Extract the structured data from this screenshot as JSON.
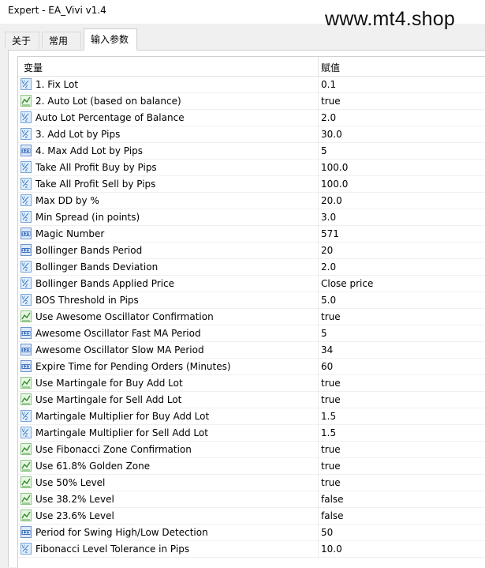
{
  "window": {
    "title": "Expert - EA_Vivi v1.4",
    "watermark": "www.mt4.shop"
  },
  "tabs": [
    {
      "label": "关于",
      "active": false
    },
    {
      "label": "常用",
      "active": false
    },
    {
      "label": "输入参数",
      "active": true
    }
  ],
  "table": {
    "col_variable": "变量",
    "col_value": "赋值",
    "rows": [
      {
        "name": "1. Fix Lot",
        "value": "0.1",
        "type": "double"
      },
      {
        "name": "2. Auto Lot (based on balance)",
        "value": "true",
        "type": "bool"
      },
      {
        "name": "Auto Lot Percentage of Balance",
        "value": "2.0",
        "type": "double"
      },
      {
        "name": "3. Add Lot by Pips",
        "value": "30.0",
        "type": "double"
      },
      {
        "name": "4. Max Add Lot by Pips",
        "value": "5",
        "type": "int"
      },
      {
        "name": "Take All Profit Buy by Pips",
        "value": "100.0",
        "type": "double"
      },
      {
        "name": "Take All Profit Sell by Pips",
        "value": "100.0",
        "type": "double"
      },
      {
        "name": "Max DD by %",
        "value": "20.0",
        "type": "double"
      },
      {
        "name": "Min Spread (in points)",
        "value": "3.0",
        "type": "double"
      },
      {
        "name": "Magic Number",
        "value": "571",
        "type": "int"
      },
      {
        "name": "Bollinger Bands Period",
        "value": "20",
        "type": "int"
      },
      {
        "name": "Bollinger Bands Deviation",
        "value": "2.0",
        "type": "double"
      },
      {
        "name": "Bollinger Bands Applied Price",
        "value": "Close price",
        "type": "double"
      },
      {
        "name": "BOS Threshold in Pips",
        "value": "5.0",
        "type": "double"
      },
      {
        "name": "Use Awesome Oscillator Confirmation",
        "value": "true",
        "type": "bool"
      },
      {
        "name": "Awesome Oscillator Fast MA Period",
        "value": "5",
        "type": "int"
      },
      {
        "name": "Awesome Oscillator Slow MA Period",
        "value": "34",
        "type": "int"
      },
      {
        "name": "Expire Time for Pending Orders (Minutes)",
        "value": "60",
        "type": "int"
      },
      {
        "name": "Use Martingale for Buy Add Lot",
        "value": "true",
        "type": "bool"
      },
      {
        "name": "Use Martingale for Sell Add Lot",
        "value": "true",
        "type": "bool"
      },
      {
        "name": "Martingale Multiplier for Buy Add Lot",
        "value": "1.5",
        "type": "double"
      },
      {
        "name": "Martingale Multiplier for Sell Add Lot",
        "value": "1.5",
        "type": "double"
      },
      {
        "name": "Use Fibonacci Zone Confirmation",
        "value": "true",
        "type": "bool"
      },
      {
        "name": "Use 61.8% Golden Zone",
        "value": "true",
        "type": "bool"
      },
      {
        "name": "Use 50% Level",
        "value": "true",
        "type": "bool"
      },
      {
        "name": "Use 38.2% Level",
        "value": "false",
        "type": "bool"
      },
      {
        "name": "Use 23.6% Level",
        "value": "false",
        "type": "bool"
      },
      {
        "name": "Period for Swing High/Low Detection",
        "value": "50",
        "type": "int"
      },
      {
        "name": "Fibonacci Level Tolerance in Pips",
        "value": "10.0",
        "type": "double"
      }
    ]
  },
  "icons": {
    "double": "double-param-icon",
    "int": "int-param-icon",
    "bool": "bool-param-icon"
  },
  "colors": {
    "icon_double_fill": "#dfeeff",
    "icon_double_text": "#1a5ea8",
    "icon_int_fill": "#3f73c2",
    "icon_int_text": "#ffffff",
    "icon_bool_fill": "#e8f6e4",
    "icon_bool_stroke": "#2f8f2a"
  }
}
